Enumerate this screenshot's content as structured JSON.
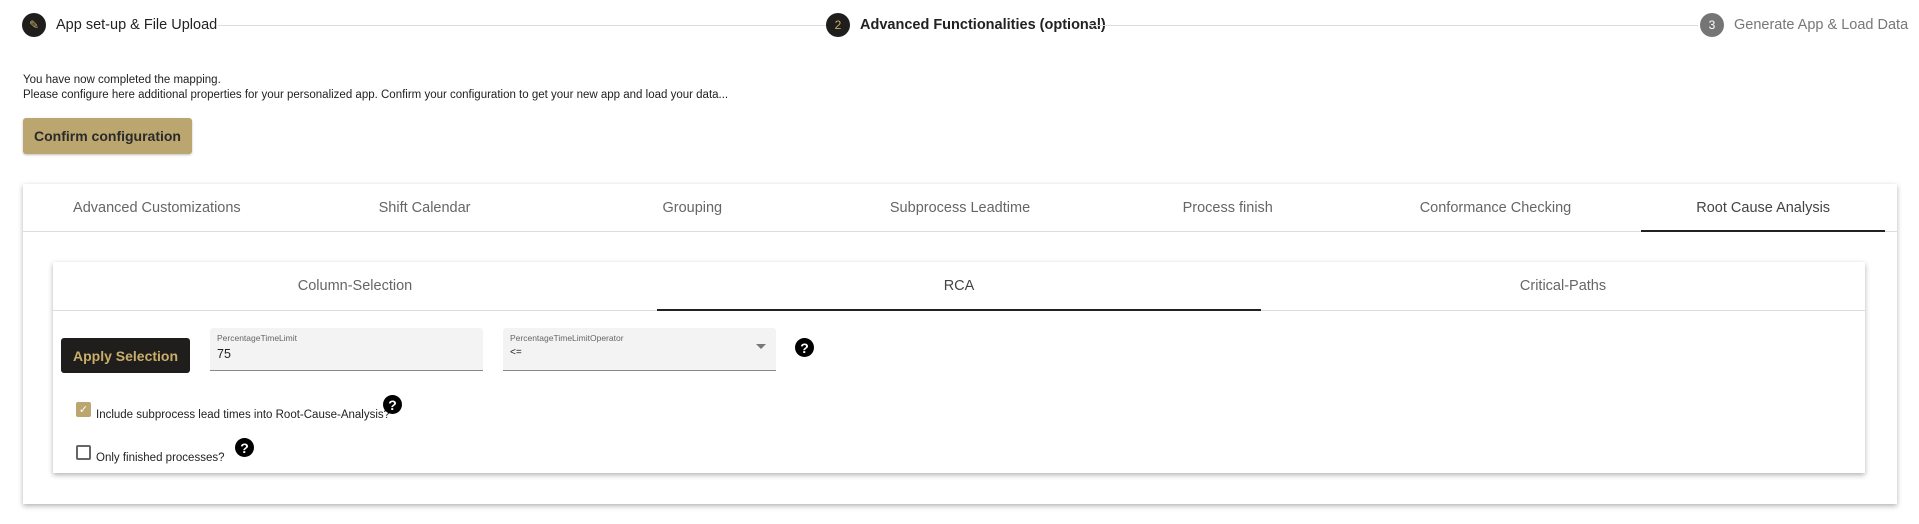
{
  "stepper": {
    "steps": [
      {
        "label": "App set-up & File Upload",
        "icon": "pencil-icon",
        "state": "completed"
      },
      {
        "label": "Advanced Functionalities (optional)",
        "number": "2",
        "state": "active"
      },
      {
        "label": "Generate App & Load Data",
        "number": "3",
        "state": "inactive"
      }
    ]
  },
  "intro": {
    "line1": "You have now completed the mapping.",
    "line2": "Please configure here additional properties for your personalized app. Confirm your configuration to get your new app and load your data..."
  },
  "confirm_label": "Confirm configuration",
  "tabs": [
    "Advanced Customizations",
    "Shift Calendar",
    "Grouping",
    "Subprocess Leadtime",
    "Process finish",
    "Conformance Checking",
    "Root Cause Analysis"
  ],
  "active_tab": "Root Cause Analysis",
  "subtabs": [
    "Column-Selection",
    "RCA",
    "Critical-Paths"
  ],
  "active_subtab": "RCA",
  "rca": {
    "apply_label": "Apply Selection",
    "time_limit": {
      "label": "PercentageTimeLimit",
      "value": "75"
    },
    "operator": {
      "label": "PercentageTimeLimitOperator",
      "value": "<="
    },
    "include_subprocess": {
      "label": "Include subprocess lead times into Root-Cause-Analysis?",
      "checked": true
    },
    "only_finished": {
      "label": "Only finished processes?",
      "checked": false
    }
  },
  "colors": {
    "accent": "#bba66f",
    "dark": "#1f1e1c"
  }
}
